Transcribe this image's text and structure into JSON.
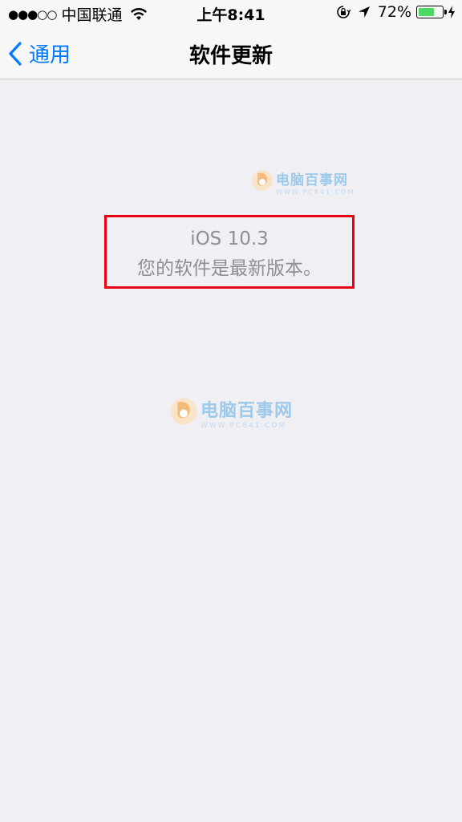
{
  "status_bar": {
    "signal": "●●●○○",
    "carrier": "中国联通",
    "time": "上午8:41",
    "battery_percent": "72%",
    "battery_level": 0.72,
    "icons": [
      "wifi-icon",
      "lock-rotation-icon",
      "location-icon",
      "battery-icon",
      "charging-icon"
    ]
  },
  "nav": {
    "back_label": "通用",
    "title": "软件更新"
  },
  "update": {
    "version": "iOS 10.3",
    "status": "您的软件是最新版本。"
  },
  "watermark": {
    "name": "电脑百事网",
    "url": "WWW.PC841.COM"
  },
  "colors": {
    "accent": "#007aff",
    "background": "#efeff4",
    "highlight_border": "#e60012",
    "battery_green": "#4cd964"
  }
}
